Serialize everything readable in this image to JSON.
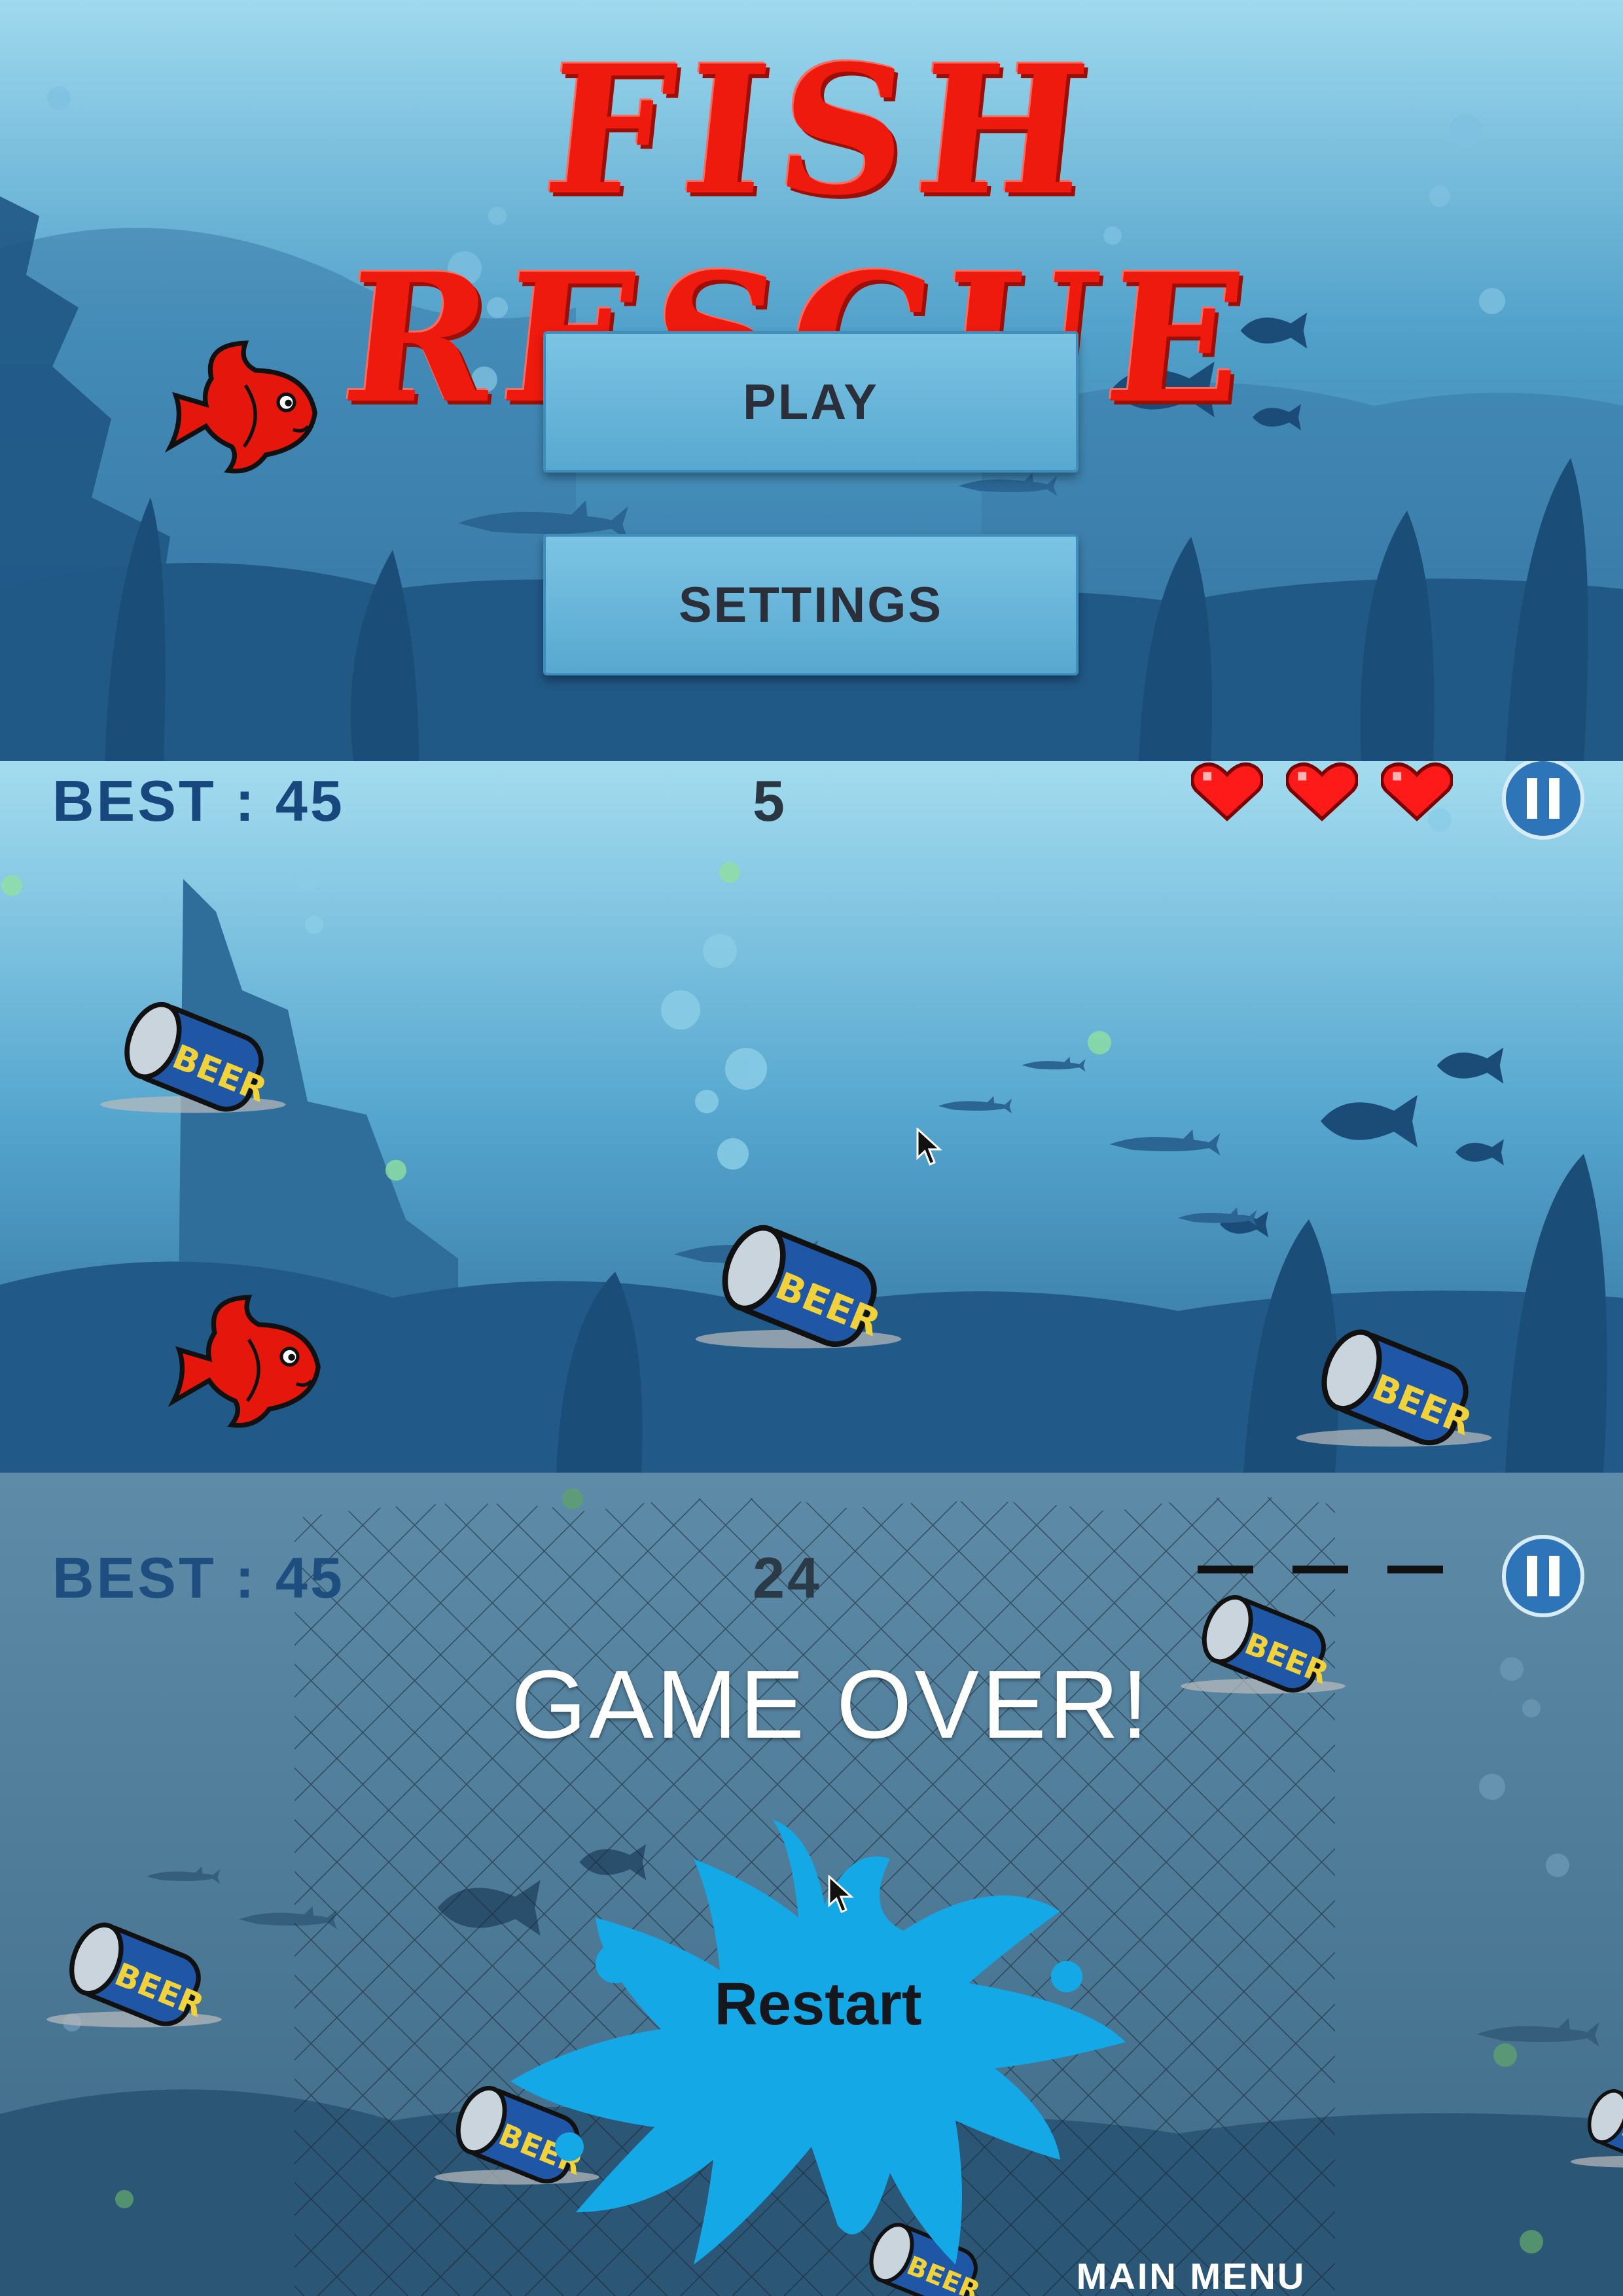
{
  "menu": {
    "title": "FISH RESCUE",
    "play_label": "PLAY",
    "settings_label": "SETTINGS"
  },
  "gameplay": {
    "best_label": "BEST : 45",
    "score": "5",
    "lives": 3,
    "pause_icon": "pause-icon"
  },
  "gameover": {
    "best_label": "BEST : 45",
    "score": "24",
    "lives": 0,
    "title": "GAME OVER!",
    "restart_label": "Restart",
    "main_menu_label": "MAIN MENU"
  },
  "colors": {
    "title_red": "#ee1a0e",
    "water_light": "#8dd2ea",
    "water_dark": "#1c4c78",
    "button_face": "#6cb8de",
    "splash_blue": "#14a9e6",
    "hud_blue": "#17477d"
  },
  "icons": [
    "red-fish-icon",
    "heart-icon",
    "pause-icon",
    "can-icon",
    "cursor-icon",
    "splash-icon",
    "fishing-net"
  ]
}
